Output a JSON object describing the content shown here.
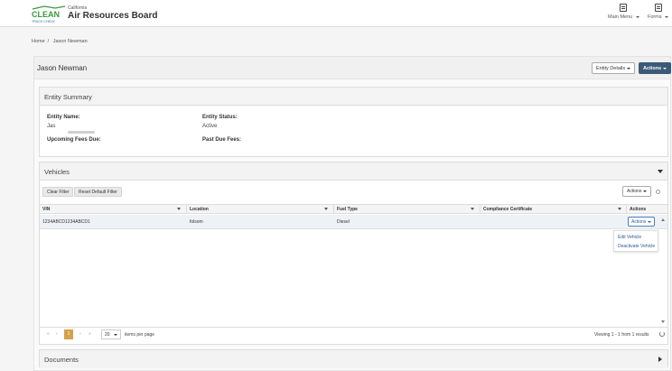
{
  "header": {
    "logo_text": "CLEAN",
    "logo_sub": "TRUCK CHECK",
    "state": "California",
    "title": "Air Resources Board",
    "nav": [
      {
        "label": "Main Menu",
        "icon": "document-icon"
      },
      {
        "label": "Forms",
        "icon": "forms-icon"
      }
    ]
  },
  "breadcrumb": {
    "home": "Home",
    "separator": "/",
    "current": "Jason Newman"
  },
  "entity": {
    "name": "Jason Newman",
    "details_button": "Entity Details",
    "actions_button": "Actions"
  },
  "summary": {
    "title": "Entity Summary",
    "entity_name_label": "Entity Name:",
    "entity_name_value": "Jas",
    "status_label": "Entity Status:",
    "status_value": "Active",
    "upcoming_label": "Upcoming Fees Due:",
    "pastdue_label": "Past Due Fees:"
  },
  "vehicles": {
    "title": "Vehicles",
    "clear_filter": "Clear Filter",
    "reset_filter": "Reset Default Filter",
    "actions_button": "Actions",
    "columns": [
      "VIN",
      "Location",
      "Fuel Type",
      "Compliance Certificate",
      "Actions"
    ],
    "rows": [
      {
        "vin": "1234ABCD1234ABCD1",
        "location": "folsom",
        "fuel_type": "Diesel",
        "compliance_certificate": "",
        "actions": "Actions"
      }
    ],
    "row_menu": [
      "Edit Vehicle",
      "Deactivate Vehicle"
    ],
    "pager": {
      "first": "«",
      "prev": "‹",
      "current_page": "1",
      "next": "›",
      "last": "»",
      "page_size": "20",
      "items_per_page": "items per page",
      "summary": "Viewing 1 - 1 from 1 results"
    }
  },
  "documents": {
    "title": "Documents"
  },
  "colors": {
    "primary": "#3a5a78",
    "active_page": "#d4a24a",
    "logo_green": "#3a9a3a",
    "logo_blue": "#2a6aa8"
  }
}
